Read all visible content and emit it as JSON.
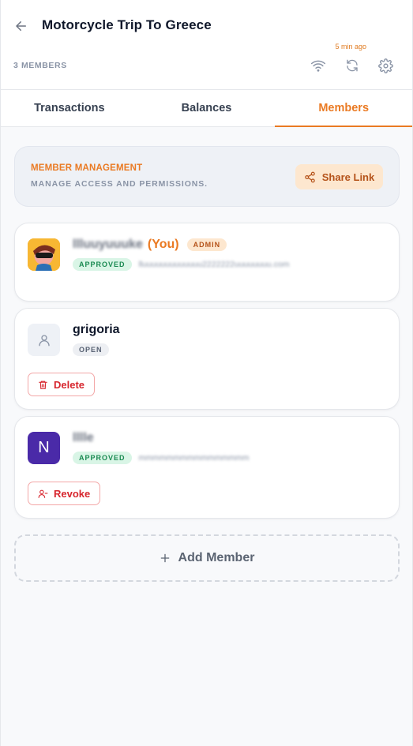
{
  "header": {
    "title": "Motorcycle Trip To Greece",
    "members_count": "3 MEMBERS",
    "updated": "5 min ago",
    "icons": [
      "back-arrow-icon",
      "wifi-icon",
      "refresh-icon",
      "gear-icon"
    ]
  },
  "tabs": [
    {
      "label": "Transactions",
      "active": false
    },
    {
      "label": "Balances",
      "active": false
    },
    {
      "label": "Members",
      "active": true
    }
  ],
  "management": {
    "title": "MEMBER MANAGEMENT",
    "subtitle": "MANAGE ACCESS AND PERMISSIONS.",
    "share_label": "Share Link"
  },
  "members": [
    {
      "name": "llluuyuuuke",
      "you_label": "(You)",
      "role": "ADMIN",
      "status": "APPROVED",
      "email": "lluuuuuuuuuuuuu2222222uuuuuuuu.com",
      "avatar": "photo"
    },
    {
      "name": "grigoria",
      "status": "OPEN",
      "action_label": "Delete",
      "avatar": "person-icon"
    },
    {
      "name": "lllle",
      "status": "APPROVED",
      "email": "mmmmmmmmmmmmmmmm",
      "avatar_letter": "N",
      "action_label": "Revoke"
    }
  ],
  "add_member_label": "Add Member",
  "colors": {
    "accent": "#ea7a23",
    "danger": "#d7262e",
    "approved": "#1b8a52",
    "avatar_purple": "#4a2aa8"
  }
}
